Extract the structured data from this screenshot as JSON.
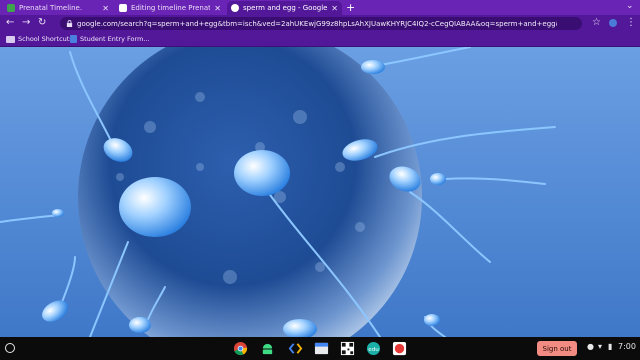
{
  "browser": {
    "tabs": [
      {
        "title": "Prenatal Timeline.",
        "favicon_color": "#3fa34d",
        "active": false
      },
      {
        "title": "Editing timeline Prenatal timeli",
        "favicon_color": "#ffffff",
        "active": false
      },
      {
        "title": "sperm and egg - Google Search",
        "favicon_color": "#ffffff",
        "active": true
      }
    ],
    "new_tab_label": "+",
    "url": "google.com/search?q=sperm+and+egg&tbm=isch&ved=2ahUKEwjG99z8hpLsAhXJUawKHYRJC4IQ2-cCegQIABAA&oq=sperm+and+egg&gs_lcp=CgNpbWcQAzICCAAyAgg",
    "bookmarks": [
      {
        "label": "School Shortcuts",
        "icon": "folder-icon"
      },
      {
        "label": "Student Entry Form...",
        "icon": "file-icon"
      }
    ]
  },
  "shelf": {
    "apps": [
      "chrome-icon",
      "android-icon",
      "code-icon",
      "files-icon",
      "qr-icon",
      "edu-icon",
      "record-icon"
    ],
    "signout_label": "Sign out",
    "time": "7:00"
  },
  "colors": {
    "tab_strip": "#6a24b5",
    "toolbar": "#53179a",
    "accent_signout": "#f28b82"
  }
}
